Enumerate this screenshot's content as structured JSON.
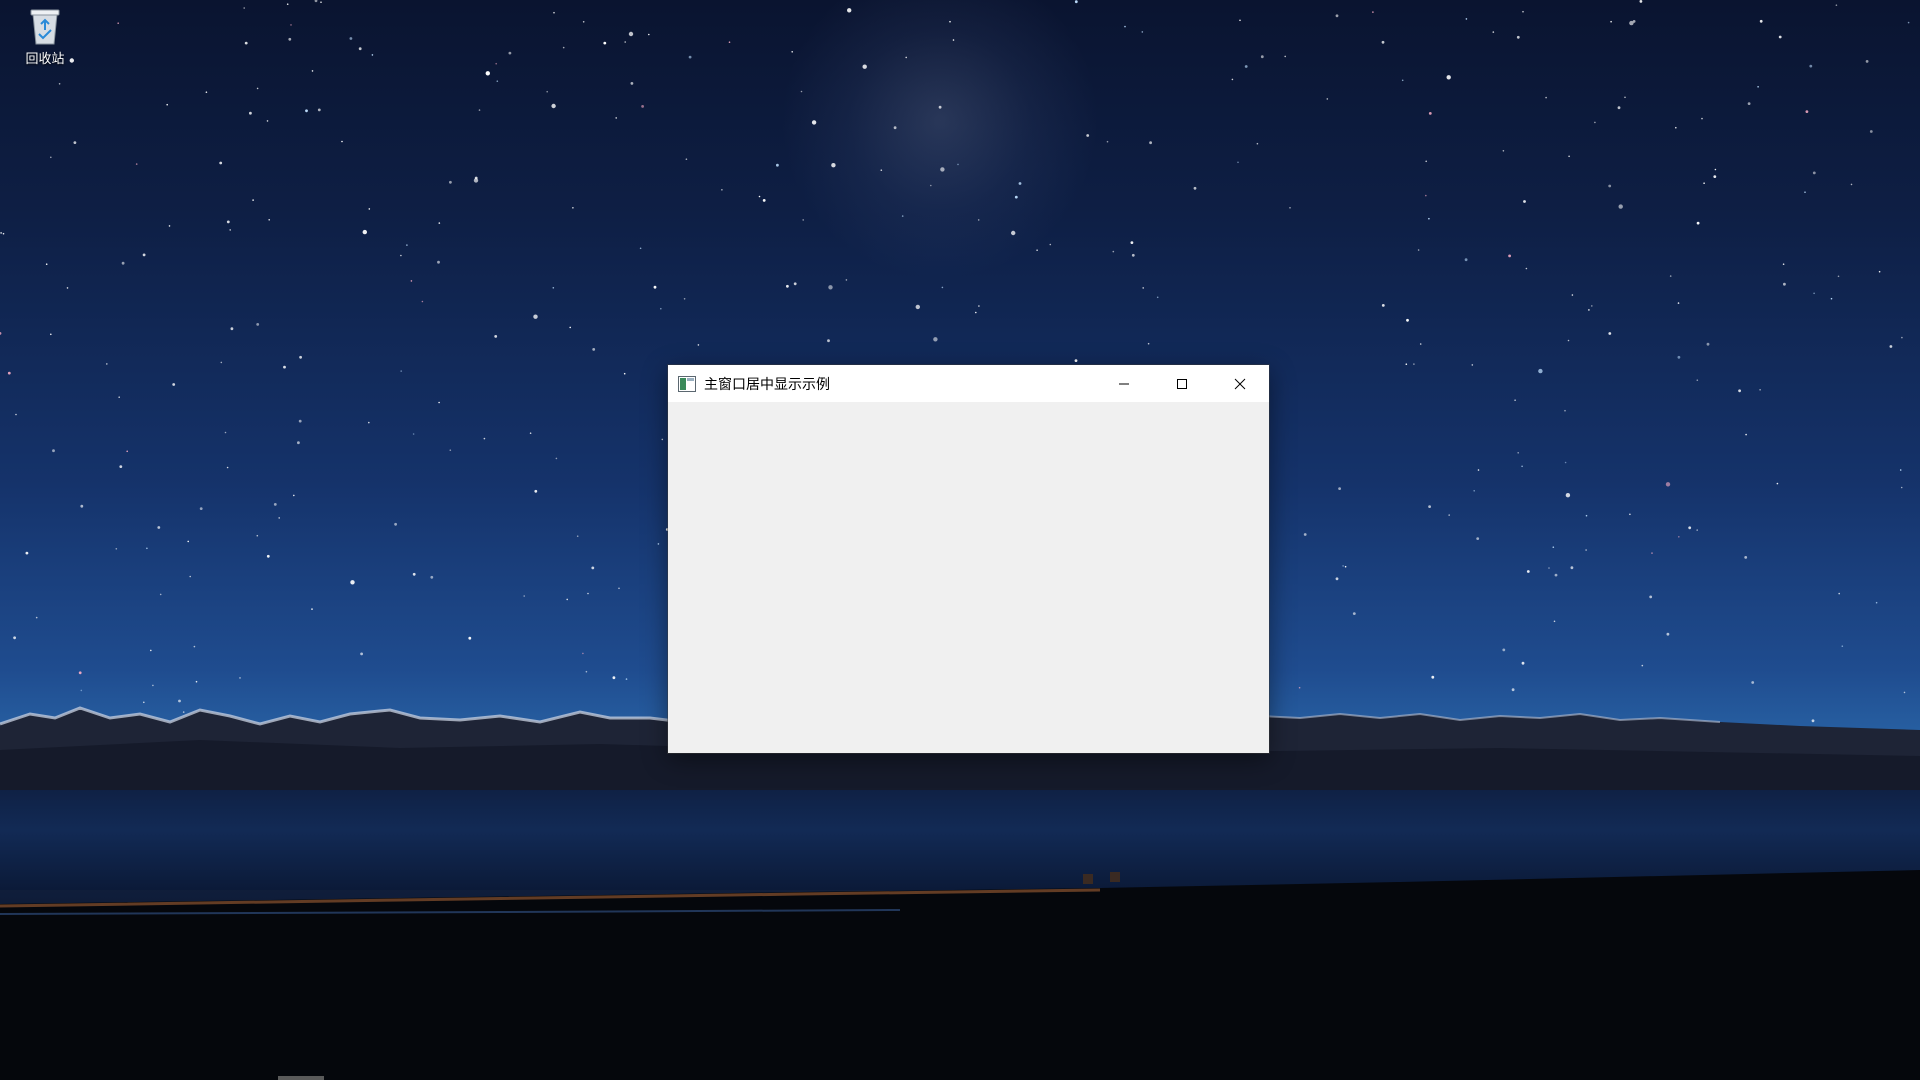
{
  "desktop": {
    "wallpaper": "starry-night-lake",
    "icons": [
      {
        "label": "回收站",
        "icon": "recycle-bin-icon"
      }
    ]
  },
  "window": {
    "title": "主窗口居中显示示例",
    "app_icon": "window-app-icon",
    "controls": {
      "minimize": "minimize-icon",
      "maximize": "maximize-icon",
      "close": "close-icon"
    },
    "client_background": "#f0f0f0",
    "titlebar_background": "#ffffff"
  },
  "colors": {
    "sky_top": "#0a1430",
    "sky_horizon": "#2a66a8",
    "ground": "#020306"
  }
}
